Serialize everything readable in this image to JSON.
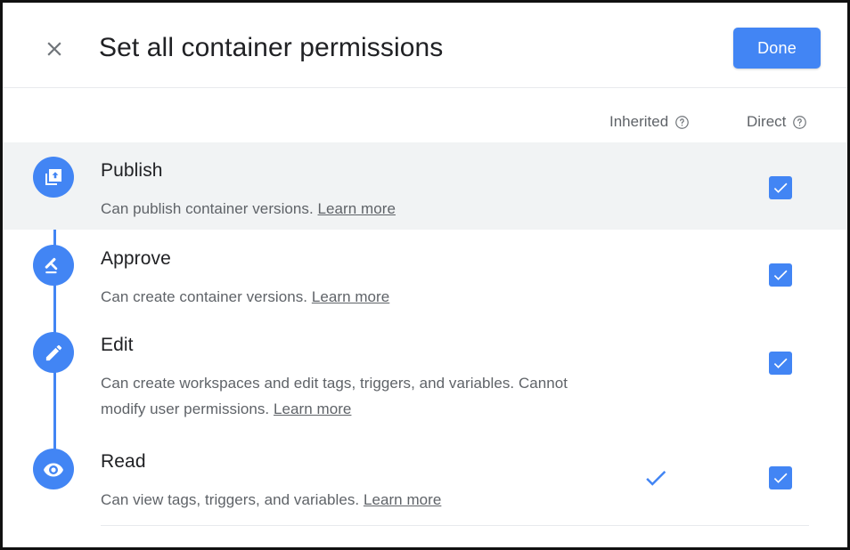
{
  "dialog": {
    "title": "Set all container permissions",
    "close_label": "Close",
    "done_label": "Done"
  },
  "columns": {
    "inherited": {
      "label": "Inherited",
      "help_tooltip": "Inherited"
    },
    "direct": {
      "label": "Direct",
      "help_tooltip": "Direct"
    }
  },
  "colors": {
    "accent": "#4285f4",
    "row_highlight": "#f1f3f4",
    "title_text": "#202124",
    "secondary_text": "#5f6368",
    "divider": "#e8eaed"
  },
  "permissions": [
    {
      "id": "publish",
      "title": "Publish",
      "description": "Can publish container versions.",
      "learn_more": "Learn more",
      "icon": "publish-icon",
      "inherited": false,
      "direct_checked": true,
      "highlighted": true
    },
    {
      "id": "approve",
      "title": "Approve",
      "description": "Can create container versions.",
      "learn_more": "Learn more",
      "icon": "gavel-icon",
      "inherited": false,
      "direct_checked": true,
      "highlighted": false
    },
    {
      "id": "edit",
      "title": "Edit",
      "description": "Can create workspaces and edit tags, triggers, and variables. Cannot modify user permissions.",
      "learn_more": "Learn more",
      "icon": "pencil-icon",
      "inherited": false,
      "direct_checked": true,
      "highlighted": false
    },
    {
      "id": "read",
      "title": "Read",
      "description": "Can view tags, triggers, and variables.",
      "learn_more": "Learn more",
      "icon": "eye-icon",
      "inherited": true,
      "direct_checked": true,
      "highlighted": false
    }
  ]
}
